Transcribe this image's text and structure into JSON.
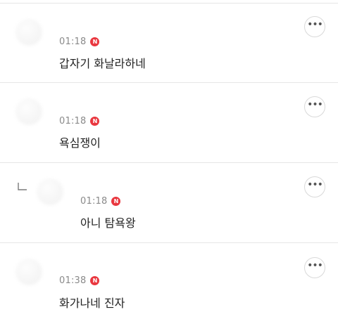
{
  "comments": [
    {
      "time": "01:18",
      "badge": "N",
      "text": "갑자기 화날라하네",
      "more_icon": "more-horizontal-icon"
    },
    {
      "time": "01:18",
      "badge": "N",
      "text": "욕심쟁이",
      "more_icon": "more-horizontal-icon"
    },
    {
      "time": "01:18",
      "badge": "N",
      "text": "아니 탐욕왕",
      "is_reply": true,
      "reply_icon": "reply-arrow-icon",
      "more_icon": "more-horizontal-icon"
    },
    {
      "time": "01:38",
      "badge": "N",
      "text": "화가나네 진자",
      "more_icon": "more-horizontal-icon"
    }
  ],
  "colors": {
    "badge": "#e9373f",
    "time": "#8a8a8a",
    "text": "#222222",
    "divider": "#e6e6e6"
  }
}
